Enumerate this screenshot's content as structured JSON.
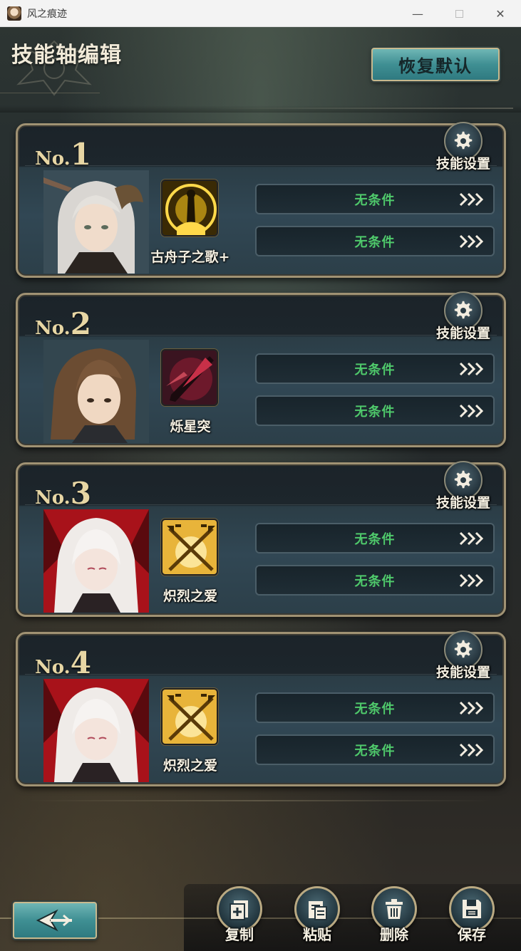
{
  "window": {
    "title": "风之痕迹",
    "minimize": "—",
    "close": "✕"
  },
  "header": {
    "title": "技能轴编辑",
    "reset_label": "恢复默认"
  },
  "cards": [
    {
      "no": "No.",
      "num": "1",
      "settings_label": "技能设置",
      "skill_name": "古舟子之歌+",
      "conditions": [
        "无条件",
        "无条件"
      ]
    },
    {
      "no": "No.",
      "num": "2",
      "settings_label": "技能设置",
      "skill_name": "烁星突",
      "conditions": [
        "无条件",
        "无条件"
      ]
    },
    {
      "no": "No.",
      "num": "3",
      "settings_label": "技能设置",
      "skill_name": "炽烈之爱",
      "conditions": [
        "无条件",
        "无条件"
      ]
    },
    {
      "no": "No.",
      "num": "4",
      "settings_label": "技能设置",
      "skill_name": "炽烈之爱",
      "conditions": [
        "无条件",
        "无条件"
      ]
    }
  ],
  "footer": {
    "actions": [
      {
        "label": "复制",
        "icon": "copy-icon"
      },
      {
        "label": "粘贴",
        "icon": "paste-icon"
      },
      {
        "label": "删除",
        "icon": "trash-icon"
      },
      {
        "label": "保存",
        "icon": "save-icon"
      }
    ],
    "back_icon": "back-arrow-icon"
  },
  "colors": {
    "condition_text": "#4fc96b",
    "teal_button": "#3f8f93",
    "gold_border": "#a09273",
    "title_text": "#f1ead8"
  }
}
